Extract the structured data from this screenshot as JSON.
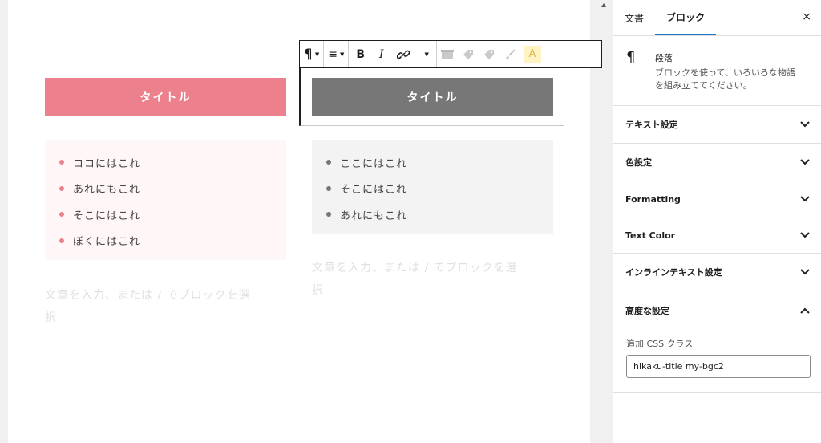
{
  "canvas": {
    "left_column": {
      "title": "タイトル",
      "list": [
        "ココにはこれ",
        "あれにもこれ",
        "そこにはこれ",
        "ぼくにはこれ"
      ],
      "placeholder": "文章を入力、または / でブロックを選択"
    },
    "right_column": {
      "title": "タイトル",
      "list": [
        "ここにはこれ",
        "そこにはこれ",
        "あれにもこれ"
      ],
      "placeholder": "文章を入力、または / でブロックを選択"
    },
    "colors": {
      "accent_pink": "#ec818d",
      "gray_title": "#777777",
      "pink_bg": "#fff7f7",
      "gray_bg": "#f3f3f3"
    }
  },
  "toolbar": {
    "paragraph_glyph": "¶",
    "align_glyph": "≡",
    "bold": "B",
    "italic": "I",
    "link_glyph": "🔗",
    "highlight": "A"
  },
  "sidebar": {
    "tabs": [
      "文書",
      "ブロック"
    ],
    "active_tab": "ブロック",
    "close": "×",
    "block": {
      "icon_glyph": "¶",
      "name": "段落",
      "description": "ブロックを使って、いろいろな物語を組み立ててください。"
    },
    "panels": [
      "テキスト設定",
      "色設定",
      "Formatting",
      "Text Color",
      "インラインテキスト設定"
    ],
    "advanced": {
      "title": "高度な設定",
      "css_label": "追加 CSS クラス",
      "css_value": "hikaku-title my-bgc2"
    },
    "accent_color": "#1a73c7"
  }
}
